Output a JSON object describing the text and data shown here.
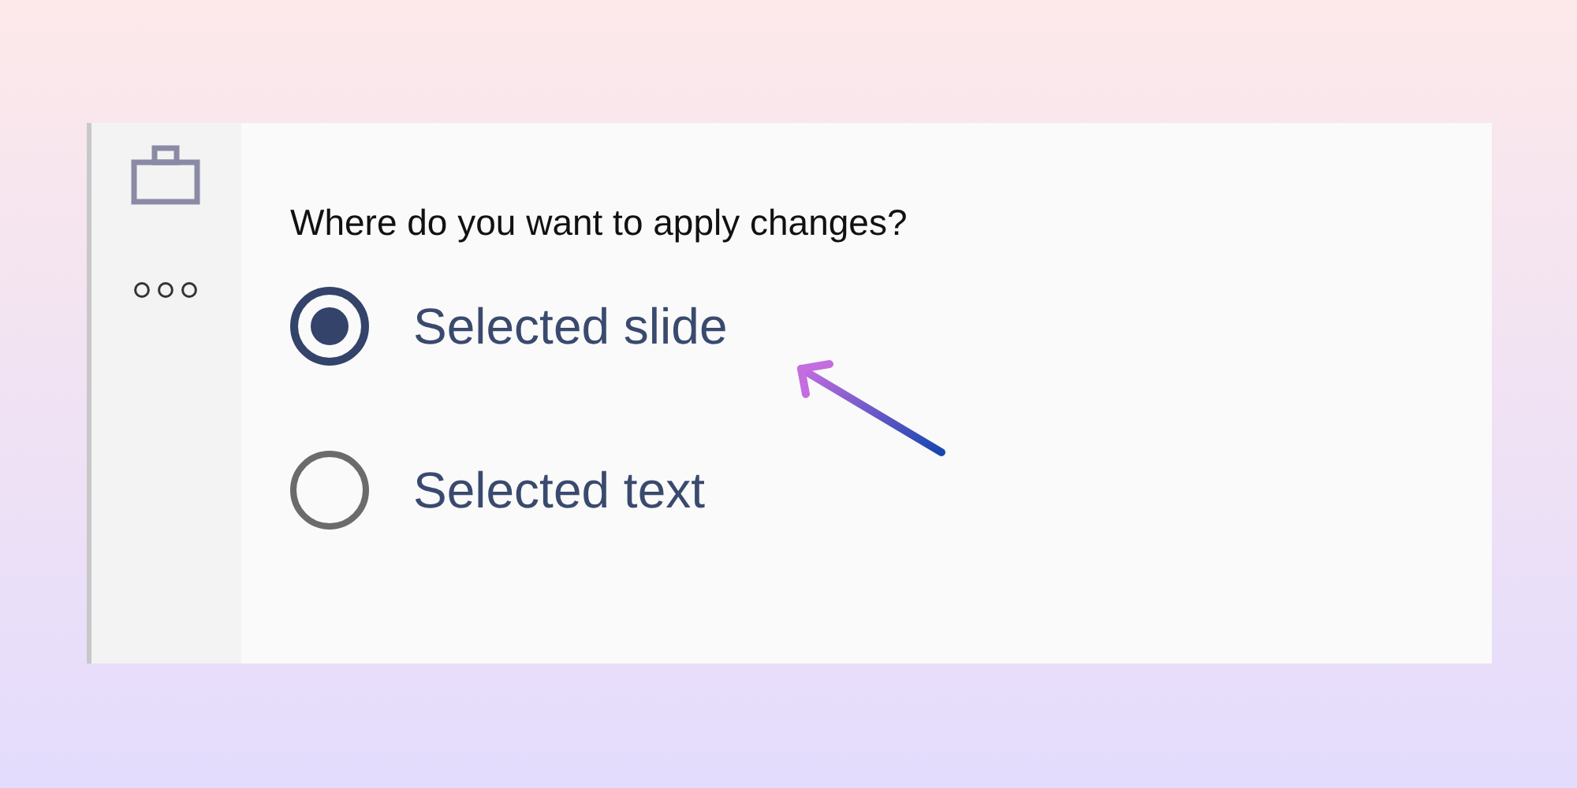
{
  "question": "Where do you want to apply changes?",
  "options": [
    {
      "label": "Selected slide",
      "selected": true
    },
    {
      "label": "Selected text",
      "selected": false
    }
  ]
}
